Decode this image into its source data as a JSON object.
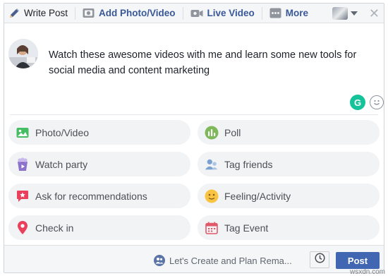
{
  "tabs": {
    "write_post": "Write Post",
    "add_photo_video": "Add Photo/Video",
    "live_video": "Live Video",
    "more": "More"
  },
  "composer": {
    "text": "Watch these awesome videos with me and learn some new tools for social media and content marketing",
    "grammarly_letter": "G"
  },
  "options": [
    {
      "label": "Photo/Video",
      "icon": "photo-icon",
      "color": "#45bd62"
    },
    {
      "label": "Poll",
      "icon": "poll-icon",
      "color": "#7fb85a"
    },
    {
      "label": "Watch party",
      "icon": "watch-party-icon",
      "color": "#8c72cb"
    },
    {
      "label": "Tag friends",
      "icon": "tag-friends-icon",
      "color": "#7aa2d0"
    },
    {
      "label": "Ask for recommendations",
      "icon": "recommendations-icon",
      "color": "#e9405b"
    },
    {
      "label": "Feeling/Activity",
      "icon": "feeling-icon",
      "color": "#f7c443"
    },
    {
      "label": "Check in",
      "icon": "check-in-icon",
      "color": "#e9405b"
    },
    {
      "label": "Tag Event",
      "icon": "tag-event-icon",
      "color": "#e05a6b"
    }
  ],
  "footer": {
    "audience": "Let's Create and Plan Rema...",
    "post_label": "Post"
  },
  "watermark": "wsxdn.com",
  "colors": {
    "link_blue": "#385898",
    "post_button": "#4267b2",
    "grammarly": "#15c39a"
  }
}
